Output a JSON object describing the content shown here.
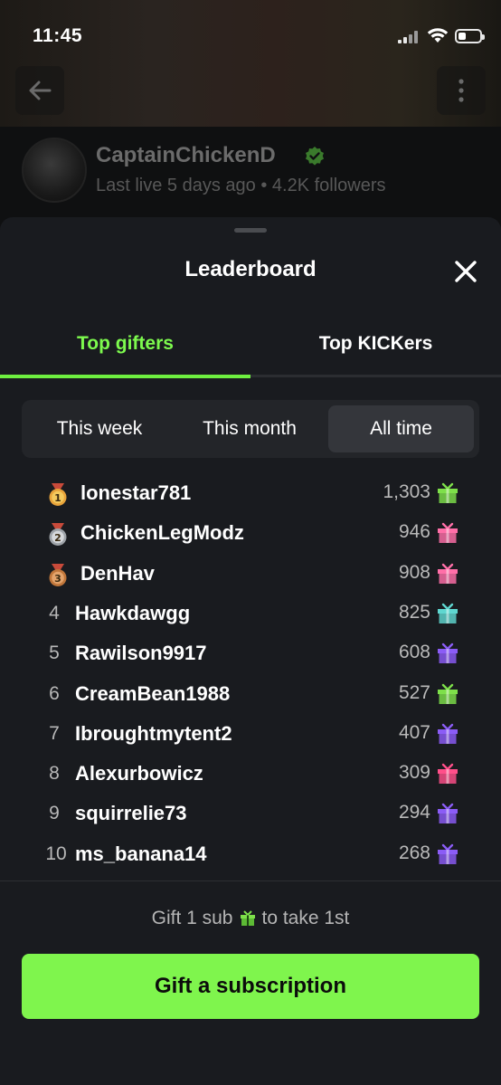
{
  "status_bar": {
    "time": "11:45"
  },
  "channel": {
    "name": "CaptainChickenD",
    "meta": "Last live 5 days ago • 4.2K followers"
  },
  "sheet": {
    "title": "Leaderboard",
    "tabs": [
      {
        "label": "Top gifters",
        "active": true
      },
      {
        "label": "Top KICKers",
        "active": false
      }
    ],
    "periods": [
      {
        "label": "This week",
        "selected": false
      },
      {
        "label": "This month",
        "selected": false
      },
      {
        "label": "All time",
        "selected": true
      }
    ],
    "leaders": [
      {
        "rank": "1",
        "name": "lonestar781",
        "count": "1,303",
        "medal": "gold",
        "gift_color": "#7ee04a"
      },
      {
        "rank": "2",
        "name": "ChickenLegModz",
        "count": "946",
        "medal": "silver",
        "gift_color": "#ff6fa8"
      },
      {
        "rank": "3",
        "name": "DenHav",
        "count": "908",
        "medal": "bronze",
        "gift_color": "#ff6fa8"
      },
      {
        "rank": "4",
        "name": "Hawkdawgg",
        "count": "825",
        "medal": "",
        "gift_color": "#5fd7d0"
      },
      {
        "rank": "5",
        "name": "Rawilson9917",
        "count": "608",
        "medal": "",
        "gift_color": "#8b5cf6"
      },
      {
        "rank": "6",
        "name": "CreamBean1988",
        "count": "527",
        "medal": "",
        "gift_color": "#7ee04a"
      },
      {
        "rank": "7",
        "name": "Ibroughtmytent2",
        "count": "407",
        "medal": "",
        "gift_color": "#8b5cf6"
      },
      {
        "rank": "8",
        "name": "Alexurbowicz",
        "count": "309",
        "medal": "",
        "gift_color": "#ff4f8a"
      },
      {
        "rank": "9",
        "name": "squirrelie73",
        "count": "294",
        "medal": "",
        "gift_color": "#8b5cf6"
      },
      {
        "rank": "10",
        "name": "ms_banana14",
        "count": "268",
        "medal": "",
        "gift_color": "#8b5cf6"
      }
    ],
    "cta_note_before": "Gift 1 sub",
    "cta_note_after": "to take 1st",
    "cta_button": "Gift a subscription"
  },
  "colors": {
    "accent": "#7ff54d",
    "sheet_bg": "#191b1f"
  },
  "icons": [
    "back-arrow-icon",
    "more-vertical-icon",
    "verified-icon",
    "close-icon",
    "gift-icon",
    "medal-icon"
  ]
}
